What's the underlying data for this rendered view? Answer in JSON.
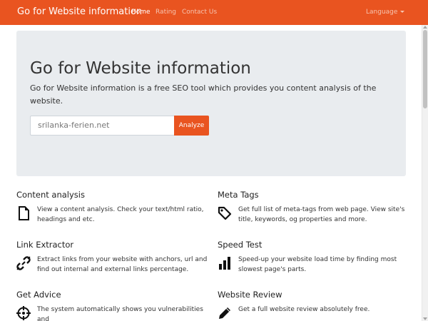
{
  "navbar": {
    "brand": "Go for Website information",
    "links": [
      {
        "label": "Home",
        "active": true
      },
      {
        "label": "Rating",
        "active": false
      },
      {
        "label": "Contact Us",
        "active": false
      }
    ],
    "language_label": "Language"
  },
  "hero": {
    "title": "Go for Website information",
    "text": "Go for Website information is a free SEO tool which provides you content analysis of the website.",
    "search_value": "srilanka-ferien.net",
    "button_label": "Analyze"
  },
  "features": [
    {
      "title": "Content analysis",
      "icon": "document-icon",
      "desc": "View a content analysis. Check your text/html ratio, headings and etc."
    },
    {
      "title": "Meta Tags",
      "icon": "tag-icon",
      "desc": "Get full list of meta-tags from web page. View site's title, keywords, og properties and more."
    },
    {
      "title": "Link Extractor",
      "icon": "link-icon",
      "desc": "Extract links from your website with anchors, url and find out internal and external links percentage."
    },
    {
      "title": "Speed Test",
      "icon": "bar-chart-icon",
      "desc": "Speed-up your website load time by finding most slowest page's parts."
    },
    {
      "title": "Get Advice",
      "icon": "crosshair-icon",
      "desc": "The system automatically shows you vulnerabilities and"
    },
    {
      "title": "Website Review",
      "icon": "pencil-icon",
      "desc": "Get a full website review absolutely free."
    }
  ],
  "colors": {
    "brand": "#e95420",
    "jumbotron": "#e9ecef"
  }
}
